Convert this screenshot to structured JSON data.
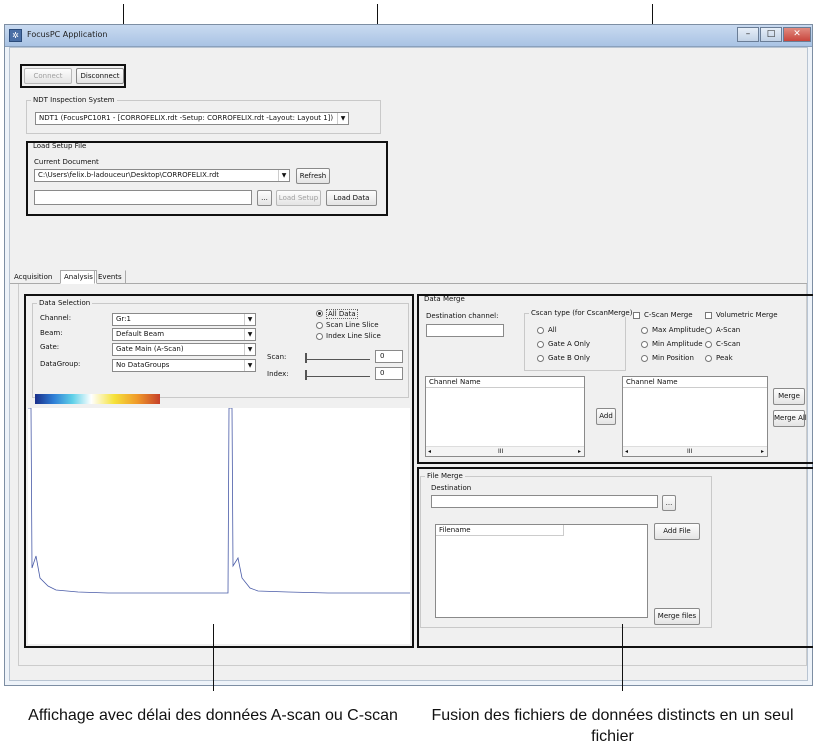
{
  "window": {
    "title": "FocusPC Application",
    "controls": [
      "–",
      "□",
      "✕"
    ]
  },
  "connection": {
    "connect_label": "Connect",
    "disconnect_label": "Disconnect"
  },
  "ndt": {
    "group_label": "NDT Inspection System",
    "system_value": "NDT1 (FocusPC10R1 - [CORROFELIX.rdt -Setup: CORROFELIX.rdt -Layout: Layout 1])"
  },
  "load_setup": {
    "group_label": "Load Setup File",
    "current_doc_label": "Current Document",
    "document_value": "C:\\Users\\felix.b-ladouceur\\Desktop\\CORROFELIX.rdt",
    "refresh_label": "Refresh",
    "browse_label": "...",
    "load_setup_label": "Load Setup",
    "load_data_label": "Load Data"
  },
  "tabs": [
    {
      "label": "Acquisition"
    },
    {
      "label": "Analysis"
    },
    {
      "label": "Events"
    }
  ],
  "data_selection": {
    "group_label": "Data Selection",
    "channel_label": "Channel:",
    "channel_value": "Gr:1",
    "beam_label": "Beam:",
    "beam_value": "Default Beam",
    "gate_label": "Gate:",
    "gate_value": "Gate Main (A-Scan)",
    "datagroup_label": "DataGroup:",
    "datagroup_value": "No DataGroups",
    "radio_all": "All Data",
    "radio_scan": "Scan Line Slice",
    "radio_index": "Index Line Slice",
    "scan_label": "Scan:",
    "scan_value": "0",
    "index_label": "Index:",
    "index_value": "0"
  },
  "data_merge": {
    "group_label": "Data Merge",
    "dest_channel_label": "Destination channel:",
    "cscan_type_label": "Cscan type (for CscanMerge)",
    "radio_all": "All",
    "radio_gate_a": "Gate A Only",
    "radio_gate_b": "Gate B Only",
    "chk_cscan_merge": "C-Scan Merge",
    "chk_volumetric": "Volumetric Merge",
    "opt_max_amp": "Max Amplitude",
    "opt_min_amp": "Min Amplitude",
    "opt_min_pos": "Min Position",
    "opt_ascan": "A-Scan",
    "opt_cscan": "C-Scan",
    "opt_peak": "Peak",
    "list1_header": "Channel Name",
    "list2_header": "Channel Name",
    "add_label": "Add",
    "merge_label": "Merge",
    "merge_all_label": "Merge All",
    "scroll_mark": "III"
  },
  "file_merge": {
    "group_label": "File Merge",
    "destination_label": "Destination",
    "browse_label": "...",
    "filename_header": "Filename",
    "add_file_label": "Add File",
    "merge_files_label": "Merge files"
  },
  "callouts": {
    "left": "Affichage avec délai des données A-scan ou C-scan",
    "right": "Fusion des fichiers de données distincts en un seul fichier"
  },
  "colors": {
    "titlebar": "#a9c3e4",
    "client": "#f0f0f0",
    "trace": "#4a5ca8",
    "close_button": "#c9463d"
  }
}
